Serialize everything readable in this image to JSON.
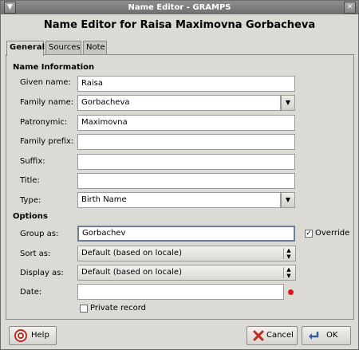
{
  "window": {
    "title": "Name Editor - GRAMPS"
  },
  "heading": "Name Editor for Raisa Maximovna Gorbacheva",
  "tabs": [
    "General",
    "Sources",
    "Note"
  ],
  "sections": {
    "name_info": "Name Information",
    "options": "Options"
  },
  "fields": {
    "given_name": {
      "label": "Given name:",
      "value": "Raisa"
    },
    "family_name": {
      "label": "Family name:",
      "value": "Gorbacheva"
    },
    "patronymic": {
      "label": "Patronymic:",
      "value": "Maximovna"
    },
    "family_prefix": {
      "label": "Family prefix:",
      "value": ""
    },
    "suffix": {
      "label": "Suffix:",
      "value": ""
    },
    "title": {
      "label": "Title:",
      "value": ""
    },
    "type": {
      "label": "Type:",
      "value": "Birth Name"
    },
    "group_as": {
      "label": "Group as:",
      "value": "Gorbachev"
    },
    "override": {
      "label": "Override",
      "checked": true
    },
    "sort_as": {
      "label": "Sort as:",
      "value": "Default (based on locale)"
    },
    "display_as": {
      "label": "Display as:",
      "value": "Default (based on locale)"
    },
    "date": {
      "label": "Date:",
      "value": ""
    },
    "private": {
      "label": "Private record",
      "checked": false
    }
  },
  "buttons": {
    "help": "Help",
    "cancel": "Cancel",
    "ok": "OK"
  },
  "colors": {
    "titlebar": "#7f7f7f",
    "background": "#dcdad5",
    "date_status": "#e2141a"
  }
}
